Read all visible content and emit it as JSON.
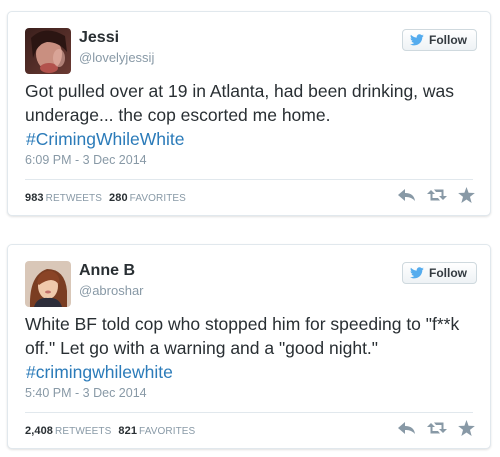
{
  "tweets": [
    {
      "name": "Jessi",
      "handle": "@lovelyjessij",
      "follow_label": "Follow",
      "text": "Got pulled over at 19 in Atlanta, had been drinking, was underage... the cop escorted me home.",
      "hashtag": "#CrimingWhileWhite",
      "timestamp": "6:09 PM - 3 Dec 2014",
      "retweet_count": "983",
      "retweets_label": "RETWEETS",
      "favorite_count": "280",
      "favorites_label": "FAVORITES",
      "avatar_icon": "avatar-photo"
    },
    {
      "name": "Anne B",
      "handle": "@abroshar",
      "follow_label": "Follow",
      "text": "White BF told cop who stopped him for speeding to \"f**k off.\" Let go with a warning and a \"good night.\"",
      "hashtag": "#crimingwhilewhite",
      "timestamp": "5:40 PM - 3 Dec 2014",
      "retweet_count": "2,408",
      "retweets_label": "RETWEETS",
      "favorite_count": "821",
      "favorites_label": "FAVORITES",
      "avatar_icon": "avatar-photo"
    }
  ],
  "icons": {
    "follow": "twitter-bird-icon",
    "reply": "reply-icon",
    "retweet": "retweet-icon",
    "favorite": "star-icon"
  },
  "colors": {
    "hashtag": "#2b7bb9",
    "meta": "#8899a6",
    "text": "#292f33",
    "bird": "#55acee",
    "action": "#8899a6"
  }
}
